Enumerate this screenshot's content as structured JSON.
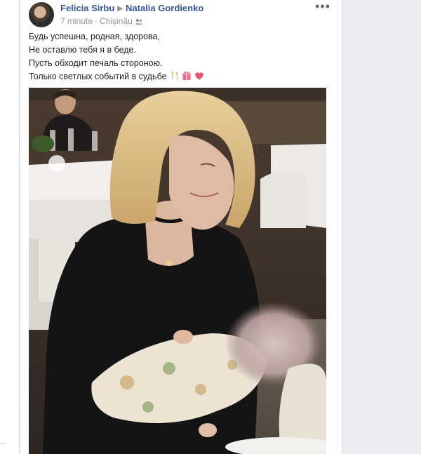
{
  "post": {
    "author": "Felicia Sirbu",
    "recipient": "Natalia Gordienko",
    "time": "7 minute",
    "location": "Chișinău",
    "more_label": "•••",
    "lines": [
      "Будь успешна, родная, здорова,",
      "Не оставлю тебя я в беде.",
      "Пусть обходит печаль стороною.",
      "Только светлых событий в судьбе"
    ],
    "emojis": [
      "champagne-glasses-icon",
      "gift-icon",
      "heart-icon"
    ]
  },
  "colors": {
    "link": "#365899",
    "meta": "#90949c",
    "text": "#1d2129",
    "page_bg": "#e9ebee"
  }
}
